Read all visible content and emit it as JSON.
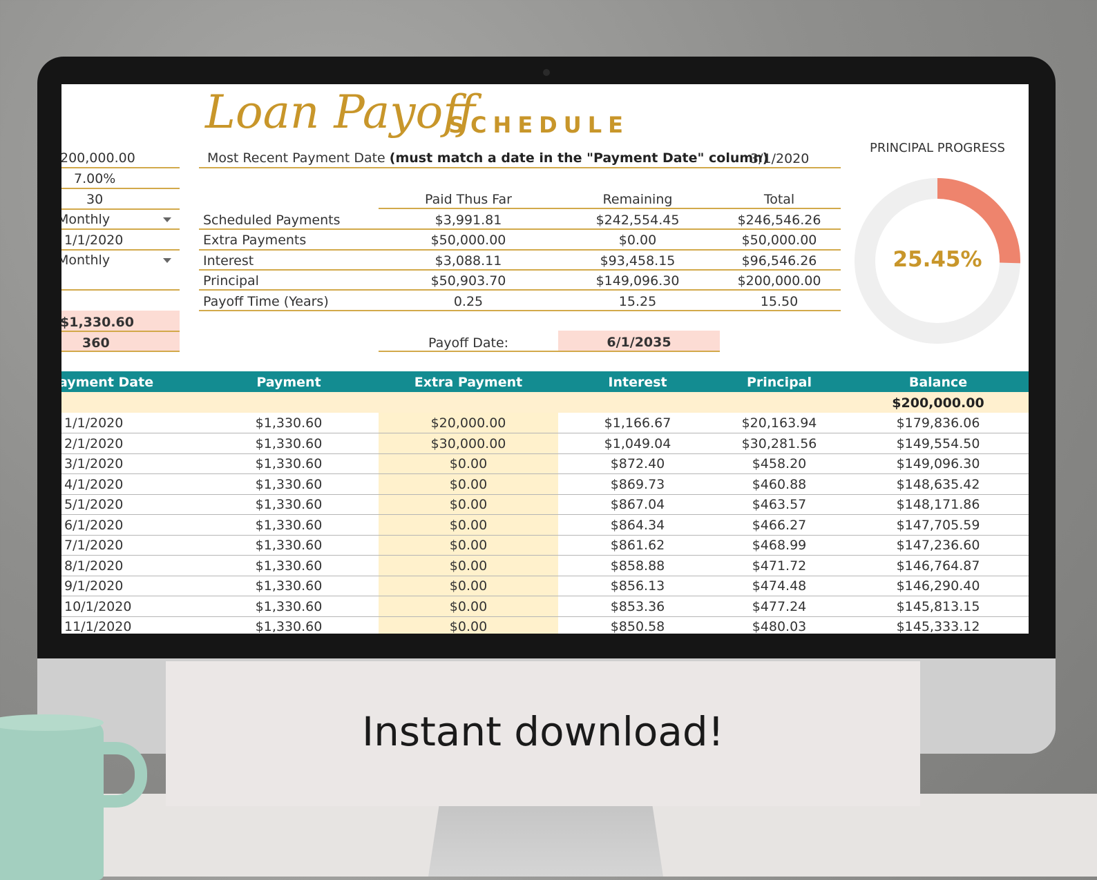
{
  "title": {
    "script": "Loan Payoff",
    "caps": "SCHEDULE"
  },
  "inputs": {
    "loan_amount": "200,000.00",
    "rate": "7.00%",
    "years": "30",
    "payment_frequency": "Monthly",
    "first_payment_date": "1/1/2020",
    "compound_period": "Monthly",
    "payment_amount": "$1,330.60",
    "num_payments": "360"
  },
  "recent_payment": {
    "label": "Most Recent Payment Date",
    "note": "(must match a date in the \"Payment Date\" column)",
    "value": "3/1/2020"
  },
  "summary": {
    "headers": [
      "Paid Thus Far",
      "Remaining",
      "Total"
    ],
    "rows": [
      {
        "label": "Scheduled Payments",
        "values": [
          "$3,991.81",
          "$242,554.45",
          "$246,546.26"
        ]
      },
      {
        "label": "Extra Payments",
        "values": [
          "$50,000.00",
          "$0.00",
          "$50,000.00"
        ]
      },
      {
        "label": "Interest",
        "values": [
          "$3,088.11",
          "$93,458.15",
          "$96,546.26"
        ]
      },
      {
        "label": "Principal",
        "values": [
          "$50,903.70",
          "$149,096.30",
          "$200,000.00"
        ]
      },
      {
        "label": "Payoff Time (Years)",
        "values": [
          "0.25",
          "15.25",
          "15.50"
        ]
      }
    ],
    "payoff_label": "Payoff Date:",
    "payoff_value": "6/1/2035"
  },
  "progress": {
    "label": "PRINCIPAL PROGRESS",
    "value_text": "25.45%",
    "fraction": 0.2545,
    "arc_color": "#ee846d",
    "track_color": "#efefef"
  },
  "table": {
    "headers": [
      "ayment Date",
      "Payment",
      "Extra Payment",
      "Interest",
      "Principal",
      "Balance"
    ],
    "opening_balance": "$200,000.00",
    "rows": [
      [
        "1/1/2020",
        "$1,330.60",
        "$20,000.00",
        "$1,166.67",
        "$20,163.94",
        "$179,836.06"
      ],
      [
        "2/1/2020",
        "$1,330.60",
        "$30,000.00",
        "$1,049.04",
        "$30,281.56",
        "$149,554.50"
      ],
      [
        "3/1/2020",
        "$1,330.60",
        "$0.00",
        "$872.40",
        "$458.20",
        "$149,096.30"
      ],
      [
        "4/1/2020",
        "$1,330.60",
        "$0.00",
        "$869.73",
        "$460.88",
        "$148,635.42"
      ],
      [
        "5/1/2020",
        "$1,330.60",
        "$0.00",
        "$867.04",
        "$463.57",
        "$148,171.86"
      ],
      [
        "6/1/2020",
        "$1,330.60",
        "$0.00",
        "$864.34",
        "$466.27",
        "$147,705.59"
      ],
      [
        "7/1/2020",
        "$1,330.60",
        "$0.00",
        "$861.62",
        "$468.99",
        "$147,236.60"
      ],
      [
        "8/1/2020",
        "$1,330.60",
        "$0.00",
        "$858.88",
        "$471.72",
        "$146,764.87"
      ],
      [
        "9/1/2020",
        "$1,330.60",
        "$0.00",
        "$856.13",
        "$474.48",
        "$146,290.40"
      ],
      [
        "10/1/2020",
        "$1,330.60",
        "$0.00",
        "$853.36",
        "$477.24",
        "$145,813.15"
      ],
      [
        "11/1/2020",
        "$1,330.60",
        "$0.00",
        "$850.58",
        "$480.03",
        "$145,333.12"
      ]
    ]
  },
  "caption": "Instant download!"
}
